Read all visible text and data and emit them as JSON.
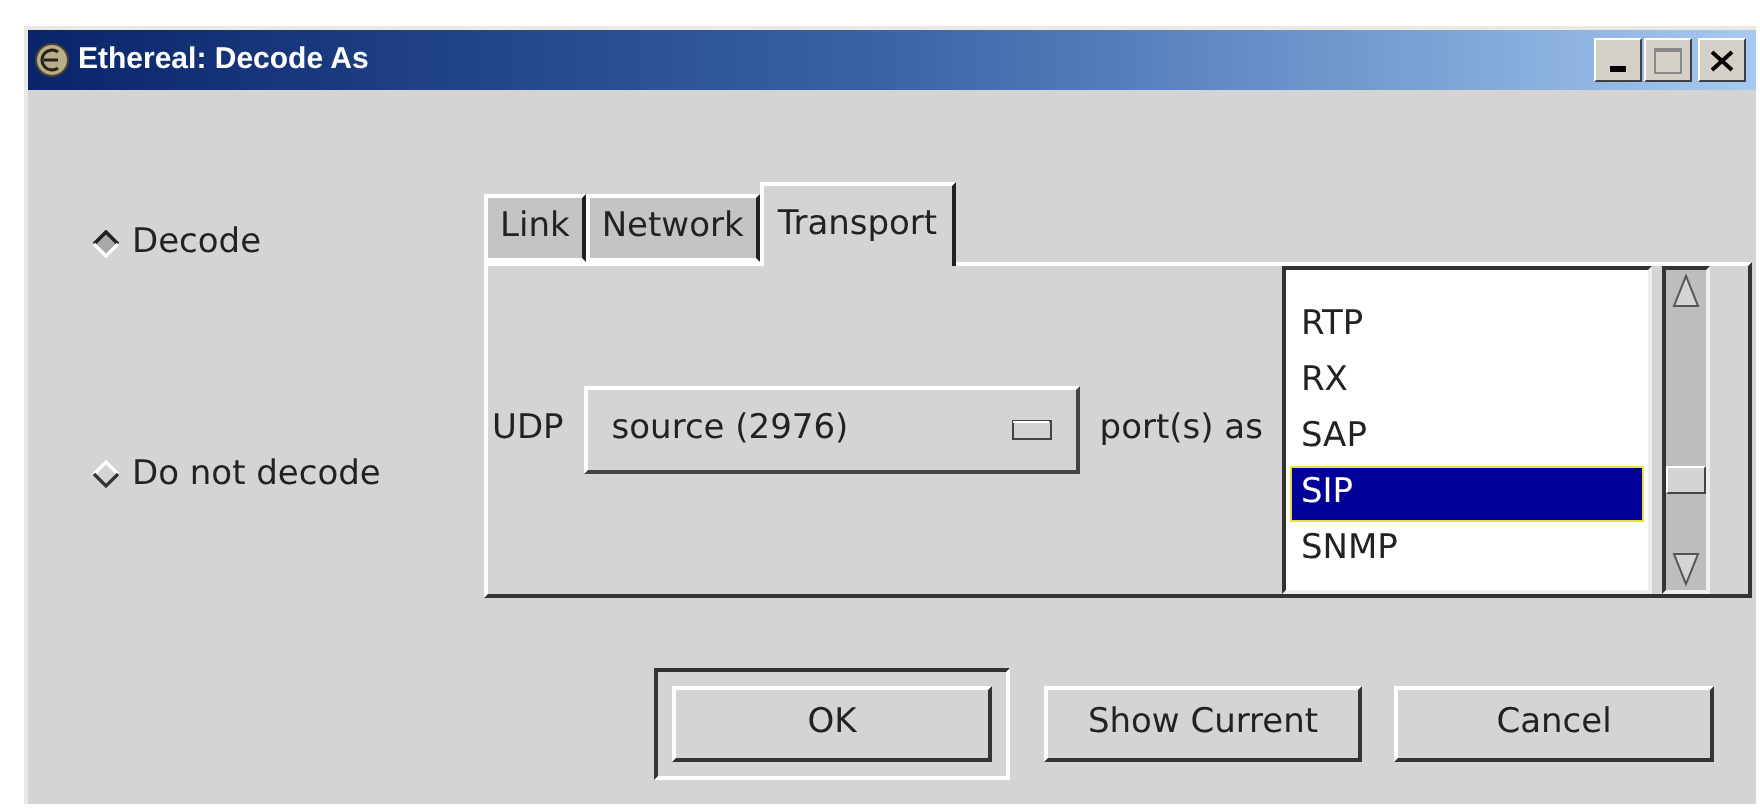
{
  "window": {
    "title": "Ethereal: Decode As"
  },
  "decode_options": [
    {
      "label": "Decode",
      "selected": true
    },
    {
      "label": "Do not decode",
      "selected": false
    }
  ],
  "tabs": [
    {
      "label": "Link",
      "selected": false
    },
    {
      "label": "Network",
      "selected": false
    },
    {
      "label": "Transport",
      "selected": true
    }
  ],
  "transport": {
    "protocol_label": "UDP",
    "port_menu": "source (2976)",
    "suffix_label": "port(s) as"
  },
  "protocol_list": [
    {
      "label": "RTP",
      "selected": false
    },
    {
      "label": "RX",
      "selected": false
    },
    {
      "label": "SAP",
      "selected": false
    },
    {
      "label": "SIP",
      "selected": true
    },
    {
      "label": "SNMP",
      "selected": false
    }
  ],
  "buttons": [
    {
      "label": "OK",
      "default": true
    },
    {
      "label": "Show Current",
      "default": false
    },
    {
      "label": "Cancel",
      "default": false
    }
  ]
}
